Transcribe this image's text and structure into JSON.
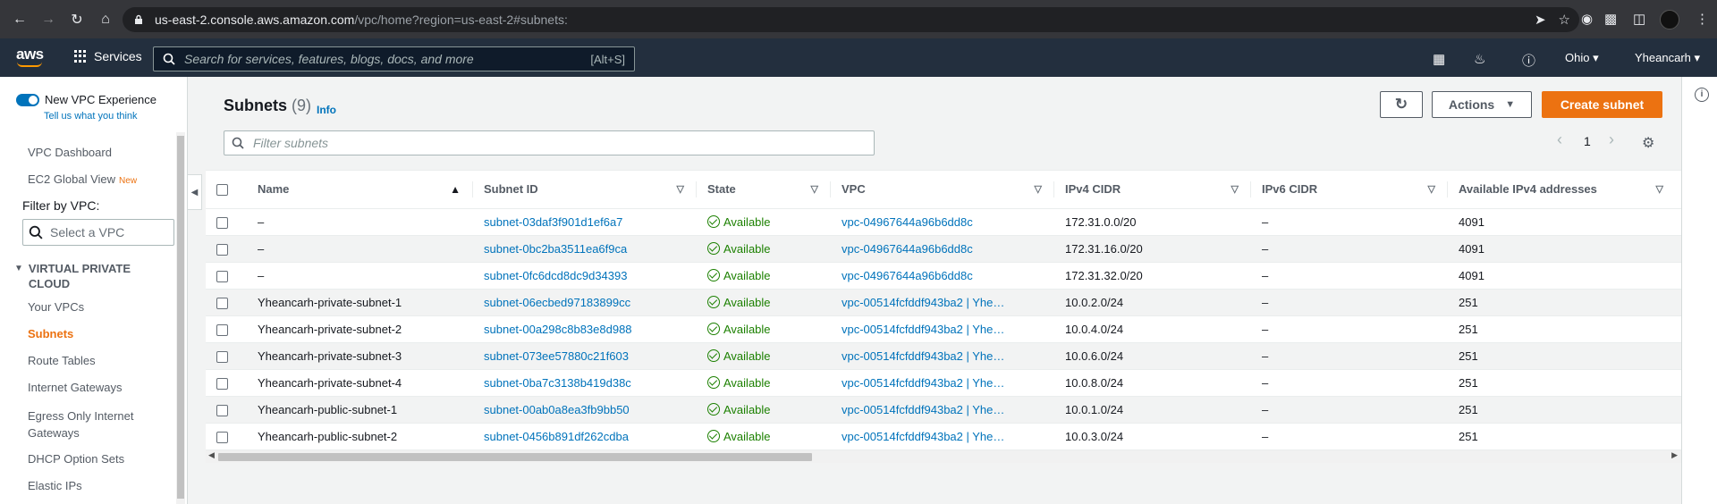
{
  "browser": {
    "url_host": "us-east-2.console.aws.amazon.com",
    "url_path": "/vpc/home?region=us-east-2#subnets:"
  },
  "topnav": {
    "logo": "aws",
    "services_label": "Services",
    "search_placeholder": "Search for services, features, blogs, docs, and more",
    "search_shortcut": "[Alt+S]",
    "region": "Ohio",
    "account": "Yheancarh"
  },
  "sidebar": {
    "toggle_label": "New VPC Experience",
    "tell_us": "Tell us what you think",
    "links_top": [
      {
        "label": "VPC Dashboard",
        "badge": ""
      },
      {
        "label": "EC2 Global View",
        "badge": "New"
      }
    ],
    "filter_label": "Filter by VPC:",
    "filter_placeholder": "Select a VPC",
    "section": "VIRTUAL PRIVATE CLOUD",
    "section_line1": "VIRTUAL PRIVATE",
    "section_line2": "CLOUD",
    "items": [
      {
        "label": "Your VPCs",
        "active": false
      },
      {
        "label": "Subnets",
        "active": true
      },
      {
        "label": "Route Tables",
        "active": false
      },
      {
        "label": "Internet Gateways",
        "active": false
      },
      {
        "label": "Egress Only Internet Gateways",
        "active": false
      },
      {
        "label": "DHCP Option Sets",
        "active": false
      },
      {
        "label": "Elastic IPs",
        "active": false
      }
    ]
  },
  "main": {
    "title": "Subnets",
    "count": "(9)",
    "info": "Info",
    "actions_label": "Actions",
    "create_label": "Create subnet",
    "filter_placeholder": "Filter subnets",
    "page": "1",
    "columns": [
      "Name",
      "Subnet ID",
      "State",
      "VPC",
      "IPv4 CIDR",
      "IPv6 CIDR",
      "Available IPv4 addresses"
    ],
    "rows": [
      {
        "name": "–",
        "subnet": "subnet-03daf3f901d1ef6a7",
        "state": "Available",
        "vpc": "vpc-04967644a96b6dd8c",
        "ipv4": "172.31.0.0/20",
        "ipv6": "–",
        "avail": "4091"
      },
      {
        "name": "–",
        "subnet": "subnet-0bc2ba3511ea6f9ca",
        "state": "Available",
        "vpc": "vpc-04967644a96b6dd8c",
        "ipv4": "172.31.16.0/20",
        "ipv6": "–",
        "avail": "4091"
      },
      {
        "name": "–",
        "subnet": "subnet-0fc6dcd8dc9d34393",
        "state": "Available",
        "vpc": "vpc-04967644a96b6dd8c",
        "ipv4": "172.31.32.0/20",
        "ipv6": "–",
        "avail": "4091"
      },
      {
        "name": "Yheancarh-private-subnet-1",
        "subnet": "subnet-06ecbed97183899cc",
        "state": "Available",
        "vpc": "vpc-00514fcfddf943ba2 | Yhe…",
        "ipv4": "10.0.2.0/24",
        "ipv6": "–",
        "avail": "251"
      },
      {
        "name": "Yheancarh-private-subnet-2",
        "subnet": "subnet-00a298c8b83e8d988",
        "state": "Available",
        "vpc": "vpc-00514fcfddf943ba2 | Yhe…",
        "ipv4": "10.0.4.0/24",
        "ipv6": "–",
        "avail": "251"
      },
      {
        "name": "Yheancarh-private-subnet-3",
        "subnet": "subnet-073ee57880c21f603",
        "state": "Available",
        "vpc": "vpc-00514fcfddf943ba2 | Yhe…",
        "ipv4": "10.0.6.0/24",
        "ipv6": "–",
        "avail": "251"
      },
      {
        "name": "Yheancarh-private-subnet-4",
        "subnet": "subnet-0ba7c3138b419d38c",
        "state": "Available",
        "vpc": "vpc-00514fcfddf943ba2 | Yhe…",
        "ipv4": "10.0.8.0/24",
        "ipv6": "–",
        "avail": "251"
      },
      {
        "name": "Yheancarh-public-subnet-1",
        "subnet": "subnet-00ab0a8ea3fb9bb50",
        "state": "Available",
        "vpc": "vpc-00514fcfddf943ba2 | Yhe…",
        "ipv4": "10.0.1.0/24",
        "ipv6": "–",
        "avail": "251"
      },
      {
        "name": "Yheancarh-public-subnet-2",
        "subnet": "subnet-0456b891df262cdba",
        "state": "Available",
        "vpc": "vpc-00514fcfddf943ba2 | Yhe…",
        "ipv4": "10.0.3.0/24",
        "ipv6": "–",
        "avail": "251"
      }
    ]
  },
  "colors": {
    "aws_orange": "#ec7211",
    "link_blue": "#0073bb",
    "status_green": "#1d8102",
    "nav_bg": "#232f3e"
  }
}
